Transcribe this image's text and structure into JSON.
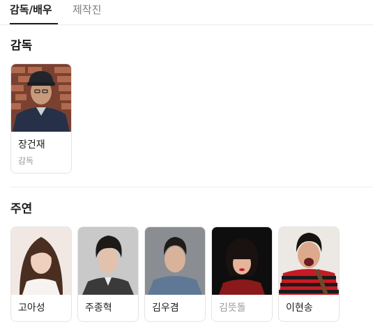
{
  "tabs": [
    {
      "label": "감독/배우",
      "active": true
    },
    {
      "label": "제작진",
      "active": false
    }
  ],
  "sections": {
    "director": {
      "title": "감독",
      "people": [
        {
          "name": "장건재",
          "role": "감독"
        }
      ]
    },
    "cast": {
      "title": "주연",
      "people": [
        {
          "name": "고아성"
        },
        {
          "name": "주종혁"
        },
        {
          "name": "김우겸"
        },
        {
          "name": "김뜻돌"
        },
        {
          "name": "이현송"
        }
      ]
    }
  },
  "colors": {
    "text": "#1c1c1c",
    "muted": "#7b7b7b",
    "border": "#e4e4e4",
    "divider": "#ececec"
  }
}
